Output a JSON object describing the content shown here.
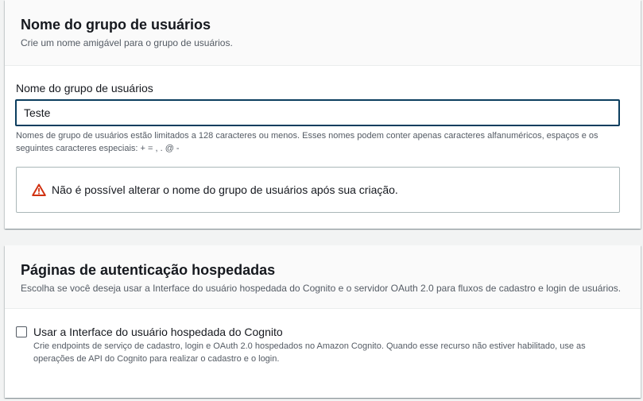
{
  "user_pool_name_section": {
    "title": "Nome do grupo de usuários",
    "description": "Crie um nome amigável para o grupo de usuários.",
    "field_label": "Nome do grupo de usuários",
    "field_value": "Teste",
    "constraint_text": "Nomes de grupo de usuários estão limitados a 128 caracteres ou menos. Esses nomes podem conter apenas caracteres alfanuméricos, espaços e os seguintes caracteres especiais: + = , . @ -",
    "warning_icon": "warning-triangle-icon",
    "warning_text": "Não é possível alterar o nome do grupo de usuários após sua criação.",
    "warning_color": "#d13212",
    "focus_border_color": "#0b3e5f"
  },
  "hosted_auth_section": {
    "title": "Páginas de autenticação hospedadas",
    "description": "Escolha se você deseja usar a Interface do usuário hospedada do Cognito e o servidor OAuth 2.0 para fluxos de cadastro e login de usuários.",
    "checkbox_label": "Usar a Interface do usuário hospedada do Cognito",
    "checkbox_checked": false,
    "checkbox_description": "Crie endpoints de serviço de cadastro, login e OAuth 2.0 hospedados no Amazon Cognito. Quando esse recurso não estiver habilitado, use as operações de API do Cognito para realizar o cadastro e o login."
  }
}
